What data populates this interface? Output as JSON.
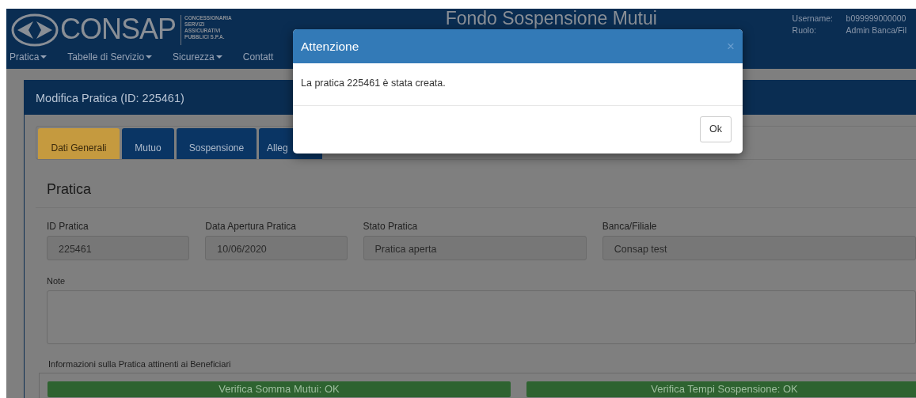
{
  "header": {
    "logo": {
      "name": "CONSAP",
      "tagline": [
        "CONCESSIONARIA",
        "SERVIZI",
        "ASSICURATIVI",
        "PUBBLICI S.P.A."
      ]
    },
    "title": "Fondo Sospensione Mutui",
    "user": [
      {
        "label": "Username:",
        "value": "b099999000000"
      },
      {
        "label": "Ruolo:",
        "value": "Admin Banca/Fil"
      }
    ]
  },
  "menu": [
    {
      "label": "Pratica",
      "dropdown": true
    },
    {
      "label": "Tabelle di Servizio",
      "dropdown": true
    },
    {
      "label": "Sicurezza",
      "dropdown": true
    },
    {
      "label": "Contatt",
      "dropdown": false
    }
  ],
  "card": {
    "title": "Modifica Pratica (ID: 225461)",
    "tabs": [
      {
        "label": "Dati Generali",
        "selected": true
      },
      {
        "label": "Mutuo",
        "selected": false
      },
      {
        "label": "Sospensione",
        "selected": false
      },
      {
        "label": "Alleg",
        "selected": false
      }
    ],
    "section": "Pratica",
    "fields": [
      {
        "label": "ID Pratica",
        "value": "225461"
      },
      {
        "label": "Data Apertura Pratica",
        "value": "10/06/2020"
      },
      {
        "label": "Stato Pratica",
        "value": "Pratica aperta"
      },
      {
        "label": "Banca/Filiale",
        "value": "Consap test"
      }
    ],
    "note": {
      "label": "Note"
    },
    "beneficiari": {
      "label": "Informazioni sulla Pratica attinenti ai Beneficiari",
      "checks": [
        "Verifica Somma Mutui: OK",
        "Verifica Tempi Sospensione: OK"
      ]
    }
  },
  "modal": {
    "title": "Attenzione",
    "close": "×",
    "message": "La pratica 225461 è stata creata.",
    "buttons": [
      "Ok"
    ]
  }
}
